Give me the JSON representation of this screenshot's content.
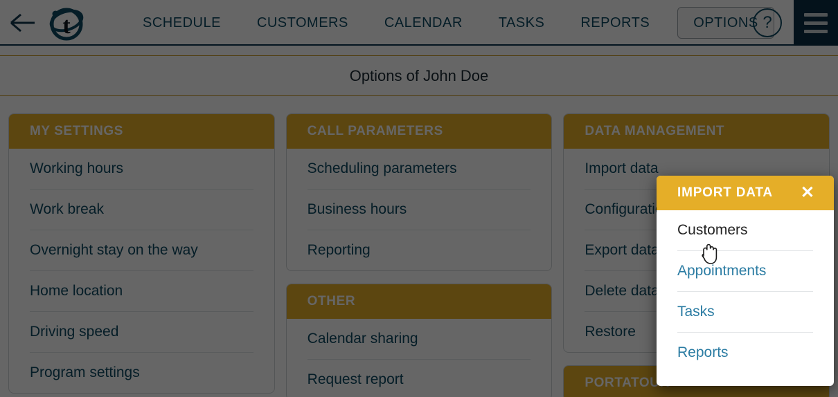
{
  "colors": {
    "accent_amber": "#e5ae28",
    "link_blue": "#0e4a63",
    "popup_link_blue": "#2b7ca3",
    "nav_dark_teal": "#0a2e44",
    "overlay": "rgba(0,0,0,0.60)"
  },
  "topnav": {
    "back_icon": "back-arrow-icon",
    "logo_icon": "portatour-t-logo",
    "links": [
      {
        "label": "SCHEDULE",
        "active": false
      },
      {
        "label": "CUSTOMERS",
        "active": false
      },
      {
        "label": "CALENDAR",
        "active": false
      },
      {
        "label": "TASKS",
        "active": false
      },
      {
        "label": "REPORTS",
        "active": false
      },
      {
        "label": "OPTIONS",
        "active": true
      }
    ],
    "help_label": "?",
    "menu_icon": "hamburger-menu-icon"
  },
  "page": {
    "title": "Options of John Doe"
  },
  "cards": {
    "my_settings": {
      "header": "MY SETTINGS",
      "items": [
        "Working hours",
        "Work break",
        "Overnight stay on the way",
        "Home location",
        "Driving speed",
        "Program settings"
      ]
    },
    "call_parameters": {
      "header": "CALL PARAMETERS",
      "items": [
        "Scheduling parameters",
        "Business hours",
        "Reporting"
      ]
    },
    "other": {
      "header": "OTHER",
      "items": [
        "Calendar sharing",
        "Request report"
      ]
    },
    "data_management": {
      "header": "DATA MANAGEMENT",
      "items": [
        "Import data",
        "Configuration",
        "Export data",
        "Delete data",
        "Restore"
      ]
    },
    "portatour": {
      "header": "PORTATOUR"
    }
  },
  "popup": {
    "title": "IMPORT DATA",
    "close_label": "✕",
    "items": [
      {
        "label": "Customers",
        "hovered": true
      },
      {
        "label": "Appointments",
        "hovered": false
      },
      {
        "label": "Tasks",
        "hovered": false
      },
      {
        "label": "Reports",
        "hovered": false
      }
    ]
  }
}
